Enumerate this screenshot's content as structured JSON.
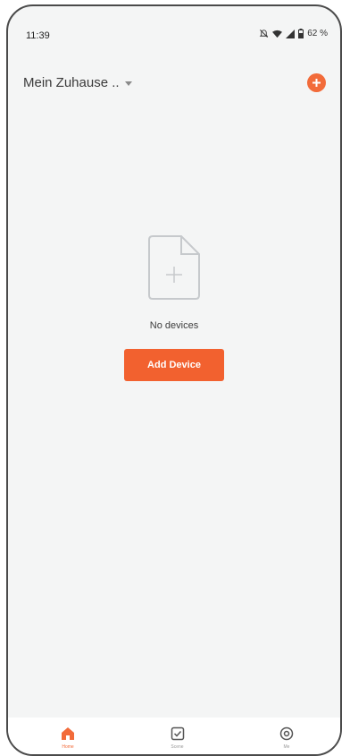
{
  "status_bar": {
    "time": "11:39",
    "battery": "62 %"
  },
  "header": {
    "home_name": "Mein Zuhause ..",
    "add_icon": "plus-circle-icon"
  },
  "empty_state": {
    "icon": "document-add-icon",
    "message": "No devices",
    "button_label": "Add Device"
  },
  "tabs": [
    {
      "label": "Home",
      "icon": "home-icon",
      "active": true
    },
    {
      "label": "Scene",
      "icon": "scene-checkbox-icon",
      "active": false
    },
    {
      "label": "Me",
      "icon": "me-profile-icon",
      "active": false
    }
  ],
  "colors": {
    "accent": "#f26b3a",
    "background": "#f4f5f5"
  }
}
